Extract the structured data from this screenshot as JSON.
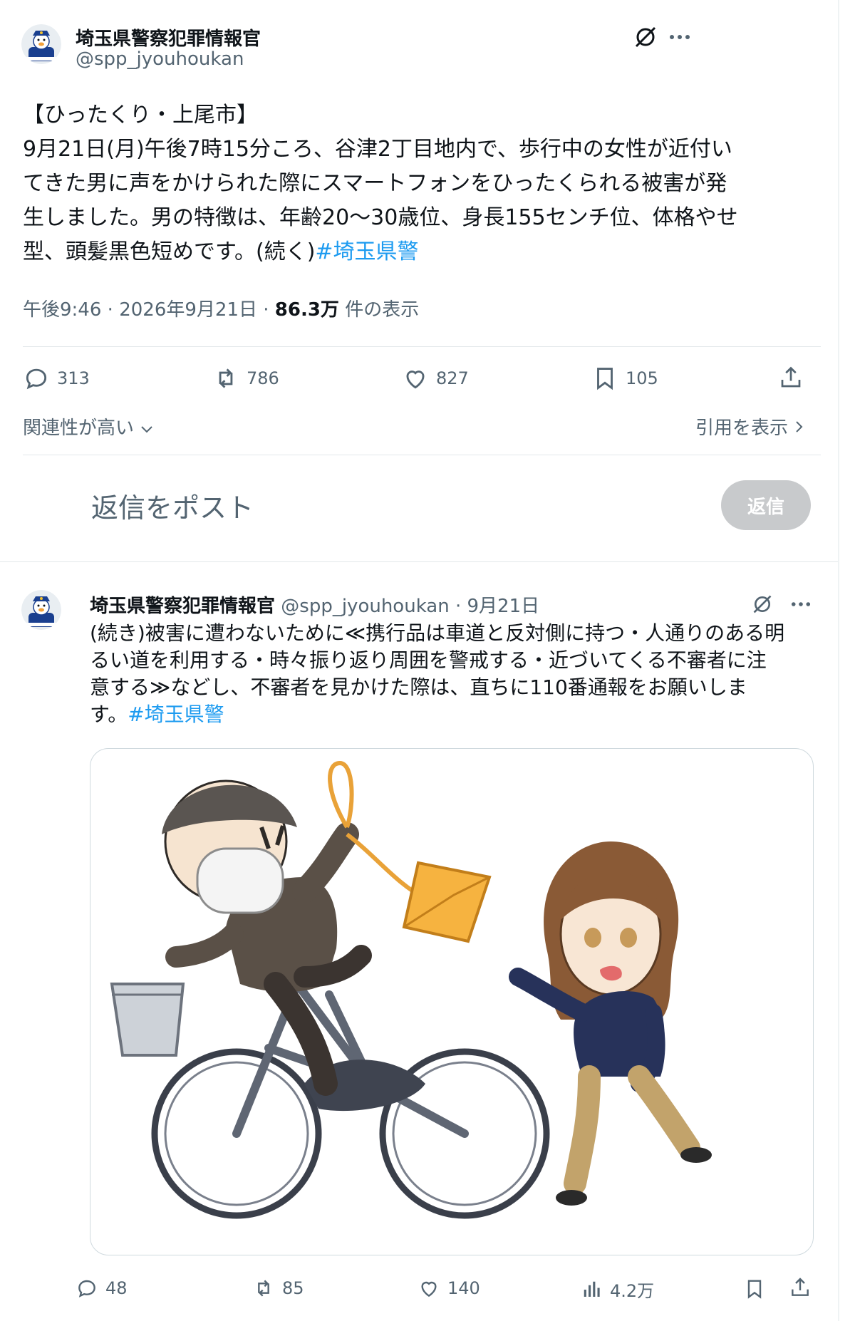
{
  "tweet": {
    "author_name": "埼玉県警察犯罪情報官",
    "author_handle": "@spp_jyouhoukan",
    "text_lines": [
      "【ひったくり・上尾市】",
      "9月21日(月)午後7時15分ころ、谷津2丁目地内で、歩行中の女性が近付い",
      "てきた男に声をかけられた際にスマートフォンをひったくられる被害が発",
      "生しました。男の特徴は、年齢20～30歳位、身長155センチ位、体格やせ",
      "型、頭髪黒色短めです。(続く)"
    ],
    "hashtag": "#埼玉県警",
    "time": "午後9:46",
    "date": "2026年9月21日",
    "views_count": "86.3万",
    "views_label": "件の表示",
    "separator": "·",
    "replies": "313",
    "reposts": "786",
    "likes": "827",
    "bookmarks": "105"
  },
  "sort": {
    "label": "関連性が高い",
    "quotes_label": "引用を表示"
  },
  "composer": {
    "placeholder": "返信をポスト",
    "button": "返信"
  },
  "reply": {
    "author_name": "埼玉県警察犯罪情報官",
    "author_handle": "@spp_jyouhoukan",
    "separator": "·",
    "date": "9月21日",
    "text_lines": [
      "(続き)被害に遭わないために≪携行品は車道と反対側に持つ・人通りのある明",
      "るい道を利用する・時々振り返り周囲を警戒する・近づいてくる不審者に注",
      "意する≫などし、不審者を見かけた際は、直ちに110番通報をお願いしま",
      "す。"
    ],
    "hashtag": "#埼玉県警",
    "replies": "48",
    "reposts": "85",
    "likes": "140",
    "views": "4.2万"
  },
  "colors": {
    "link": "#1d9bf0",
    "muted": "#536471",
    "text": "#0f1419",
    "button_disabled": "#c8cacc"
  }
}
